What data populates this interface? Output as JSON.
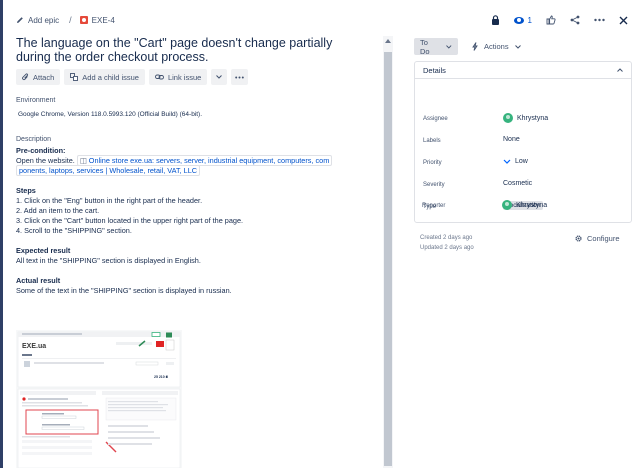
{
  "breadcrumb": {
    "add_epic": "Add epic",
    "separator": "/",
    "issue_key": "EXE-4"
  },
  "top_actions": {
    "watchers_count": "1"
  },
  "issue": {
    "title": "The language on the \"Cart\" page doesn't change partially during the order checkout process.",
    "buttons": {
      "attach": "Attach",
      "add_child": "Add a child issue",
      "link_issue": "Link issue"
    },
    "environment_label": "Environment",
    "environment_value": "Google Chrome, Version 118.0.5993.120 (Official Build) (64-bit).",
    "description_label": "Description",
    "precondition_heading": "Pre-condition:",
    "precondition_text": "Open the website.",
    "link_text_1": "Online store exe.ua: servers, server, industrial equipment, computers, com",
    "link_text_2": "ponents, laptops, services | Wholesale, retail, VAT, LLC",
    "steps_heading": "Steps",
    "steps": [
      "1. Click on the \"Eng\" button in the right part of the header.",
      "2. Add an item to the cart.",
      "3. Click on the \"Cart\" button located in the upper right part of the page.",
      "4. Scroll to the \"SHIPPING\" section."
    ],
    "expected_heading": "Expected result",
    "expected_text": "All text in the \"SHIPPING\" section is displayed in English.",
    "actual_heading": "Actual result",
    "actual_text": "Some of the text in the \"SHIPPING\" section is displayed in russian."
  },
  "attachment": {
    "logo_text": "EXE.ua",
    "price_text": "25 210 ₴"
  },
  "sidebar": {
    "status": "To Do",
    "actions": "Actions",
    "details_title": "Details",
    "fields": [
      {
        "label": "Assignee",
        "value": "Khrystyna"
      },
      {
        "label": "Labels",
        "value": "None"
      },
      {
        "label": "Priority",
        "value": "Low"
      },
      {
        "label": "Severity",
        "value": "Cosmetic"
      },
      {
        "label": "Type",
        "value": "Localization"
      },
      {
        "label": "Reporter",
        "value": "Khrystyna"
      }
    ],
    "created": "Created 2 days ago",
    "updated": "Updated 2 days ago",
    "configure": "Configure"
  },
  "colors": {
    "accent": "#0052cc",
    "issue_icon": "#e5493a",
    "avatar": "#36b37e",
    "priority_low": "#0065ff"
  }
}
